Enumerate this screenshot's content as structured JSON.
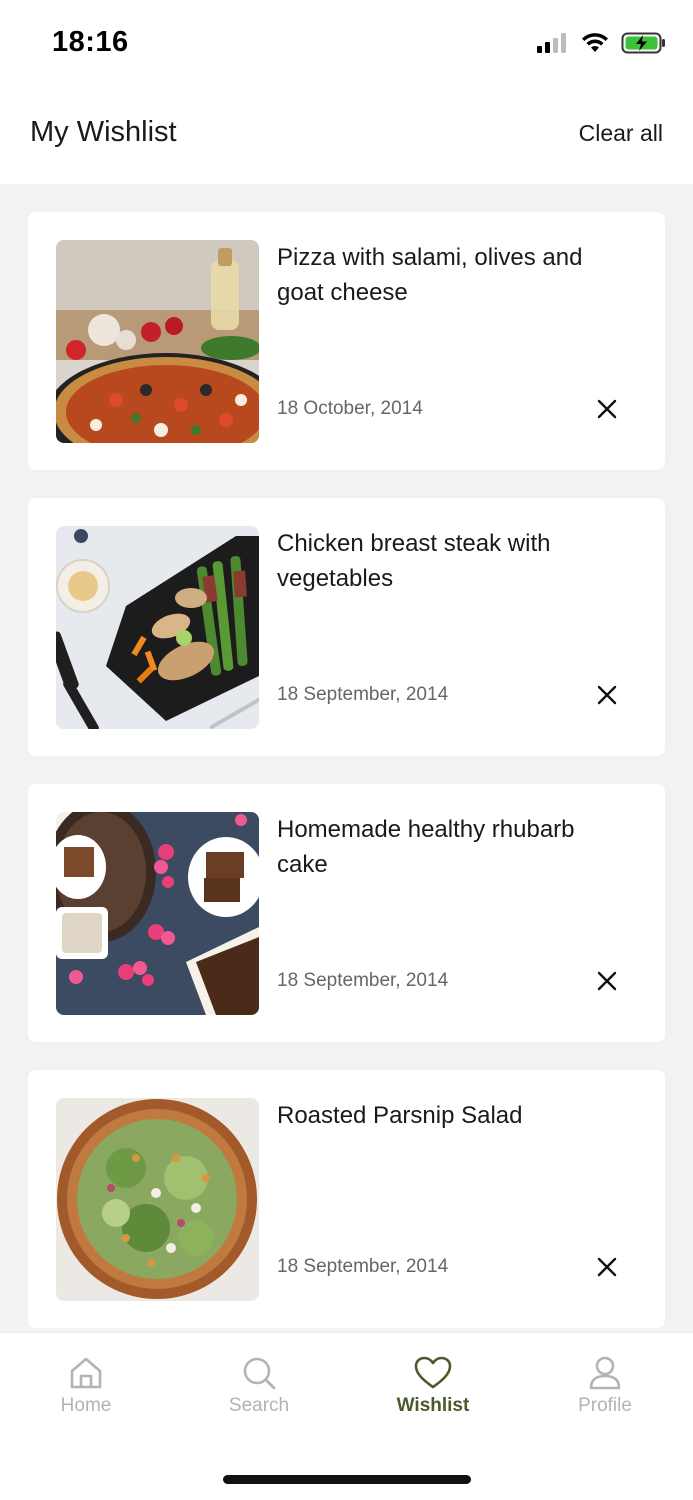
{
  "status_bar": {
    "time": "18:16"
  },
  "header": {
    "title": "My Wishlist",
    "clear_label": "Clear all"
  },
  "wishlist": [
    {
      "title": "Pizza with salami, olives and goat cheese",
      "date": "18 October, 2014",
      "image": "pizza-photo"
    },
    {
      "title": "Chicken breast steak with vegetables",
      "date": "18 September, 2014",
      "image": "chicken-steak-photo"
    },
    {
      "title": "Homemade healthy rhubarb cake",
      "date": "18 September, 2014",
      "image": "rhubarb-cake-photo"
    },
    {
      "title": "Roasted Parsnip Salad",
      "date": "18 September, 2014",
      "image": "parsnip-salad-photo"
    }
  ],
  "tabs": [
    {
      "label": "Home",
      "icon": "home-icon",
      "active": false
    },
    {
      "label": "Search",
      "icon": "search-icon",
      "active": false
    },
    {
      "label": "Wishlist",
      "icon": "heart-icon",
      "active": true
    },
    {
      "label": "Profile",
      "icon": "profile-icon",
      "active": false
    }
  ],
  "colors": {
    "accent": "#4a5a2a",
    "inactive": "#b3b3b3",
    "background": "#f2f2f2",
    "battery": "#3cc13b"
  }
}
